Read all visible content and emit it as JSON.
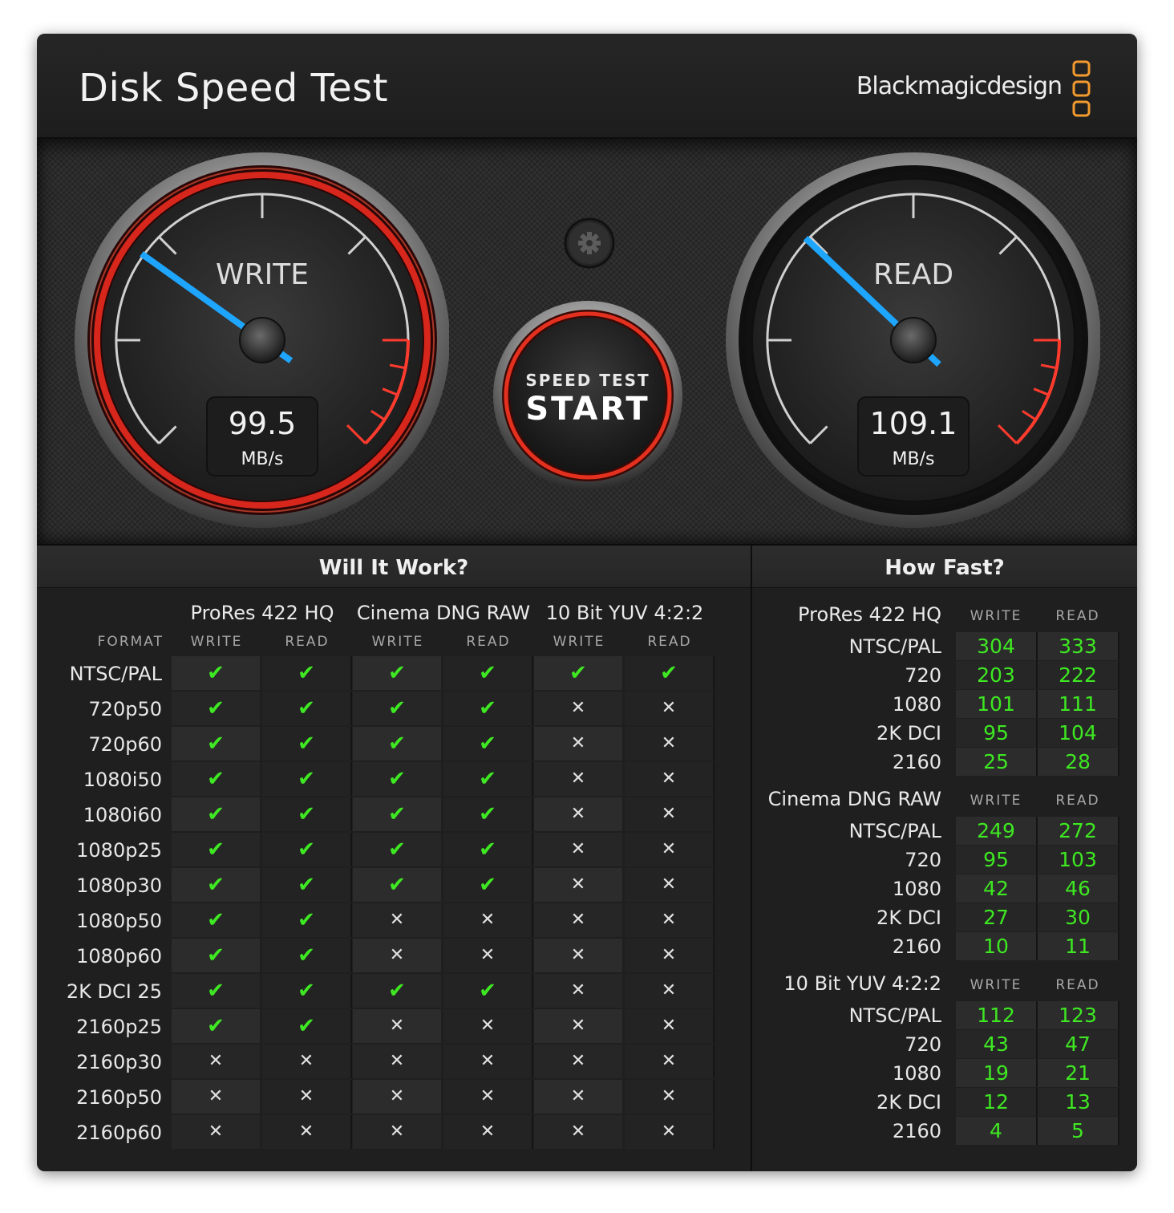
{
  "app": {
    "title": "Disk Speed Test",
    "brand": "Blackmagicdesign",
    "close_symbol": "✕",
    "brand_color": "#f29a2e"
  },
  "gauges": {
    "write": {
      "label": "WRITE",
      "value": "99.5",
      "unit": "MB/s"
    },
    "read": {
      "label": "READ",
      "value": "109.1",
      "unit": "MB/s"
    }
  },
  "start_button": {
    "line1": "SPEED TEST",
    "line2": "START"
  },
  "settings_button": {
    "icon": "gear-icon"
  },
  "will_it_work": {
    "title": "Will It Work?",
    "format_label": "FORMAT",
    "codecs": [
      "ProRes 422 HQ",
      "Cinema DNG RAW",
      "10 Bit YUV 4:2:2"
    ],
    "col_labels": [
      "WRITE",
      "READ"
    ],
    "ok_symbol": "✔",
    "fail_symbol": "✕",
    "rows": [
      {
        "format": "NTSC/PAL",
        "cells": [
          1,
          1,
          1,
          1,
          1,
          1
        ]
      },
      {
        "format": "720p50",
        "cells": [
          1,
          1,
          1,
          1,
          0,
          0
        ]
      },
      {
        "format": "720p60",
        "cells": [
          1,
          1,
          1,
          1,
          0,
          0
        ]
      },
      {
        "format": "1080i50",
        "cells": [
          1,
          1,
          1,
          1,
          0,
          0
        ]
      },
      {
        "format": "1080i60",
        "cells": [
          1,
          1,
          1,
          1,
          0,
          0
        ]
      },
      {
        "format": "1080p25",
        "cells": [
          1,
          1,
          1,
          1,
          0,
          0
        ]
      },
      {
        "format": "1080p30",
        "cells": [
          1,
          1,
          1,
          1,
          0,
          0
        ]
      },
      {
        "format": "1080p50",
        "cells": [
          1,
          1,
          0,
          0,
          0,
          0
        ]
      },
      {
        "format": "1080p60",
        "cells": [
          1,
          1,
          0,
          0,
          0,
          0
        ]
      },
      {
        "format": "2K DCI 25",
        "cells": [
          1,
          1,
          1,
          1,
          0,
          0
        ]
      },
      {
        "format": "2160p25",
        "cells": [
          1,
          1,
          0,
          0,
          0,
          0
        ]
      },
      {
        "format": "2160p30",
        "cells": [
          0,
          0,
          0,
          0,
          0,
          0
        ]
      },
      {
        "format": "2160p50",
        "cells": [
          0,
          0,
          0,
          0,
          0,
          0
        ]
      },
      {
        "format": "2160p60",
        "cells": [
          0,
          0,
          0,
          0,
          0,
          0
        ]
      }
    ]
  },
  "how_fast": {
    "title": "How Fast?",
    "col_labels": [
      "WRITE",
      "READ"
    ],
    "groups": [
      {
        "codec": "ProRes 422 HQ",
        "rows": [
          {
            "label": "NTSC/PAL",
            "write": "304",
            "read": "333"
          },
          {
            "label": "720",
            "write": "203",
            "read": "222"
          },
          {
            "label": "1080",
            "write": "101",
            "read": "111"
          },
          {
            "label": "2K DCI",
            "write": "95",
            "read": "104"
          },
          {
            "label": "2160",
            "write": "25",
            "read": "28"
          }
        ]
      },
      {
        "codec": "Cinema DNG RAW",
        "rows": [
          {
            "label": "NTSC/PAL",
            "write": "249",
            "read": "272"
          },
          {
            "label": "720",
            "write": "95",
            "read": "103"
          },
          {
            "label": "1080",
            "write": "42",
            "read": "46"
          },
          {
            "label": "2K DCI",
            "write": "27",
            "read": "30"
          },
          {
            "label": "2160",
            "write": "10",
            "read": "11"
          }
        ]
      },
      {
        "codec": "10 Bit YUV 4:2:2",
        "rows": [
          {
            "label": "NTSC/PAL",
            "write": "112",
            "read": "123"
          },
          {
            "label": "720",
            "write": "43",
            "read": "47"
          },
          {
            "label": "1080",
            "write": "19",
            "read": "21"
          },
          {
            "label": "2K DCI",
            "write": "12",
            "read": "13"
          },
          {
            "label": "2160",
            "write": "4",
            "read": "5"
          }
        ]
      }
    ]
  }
}
